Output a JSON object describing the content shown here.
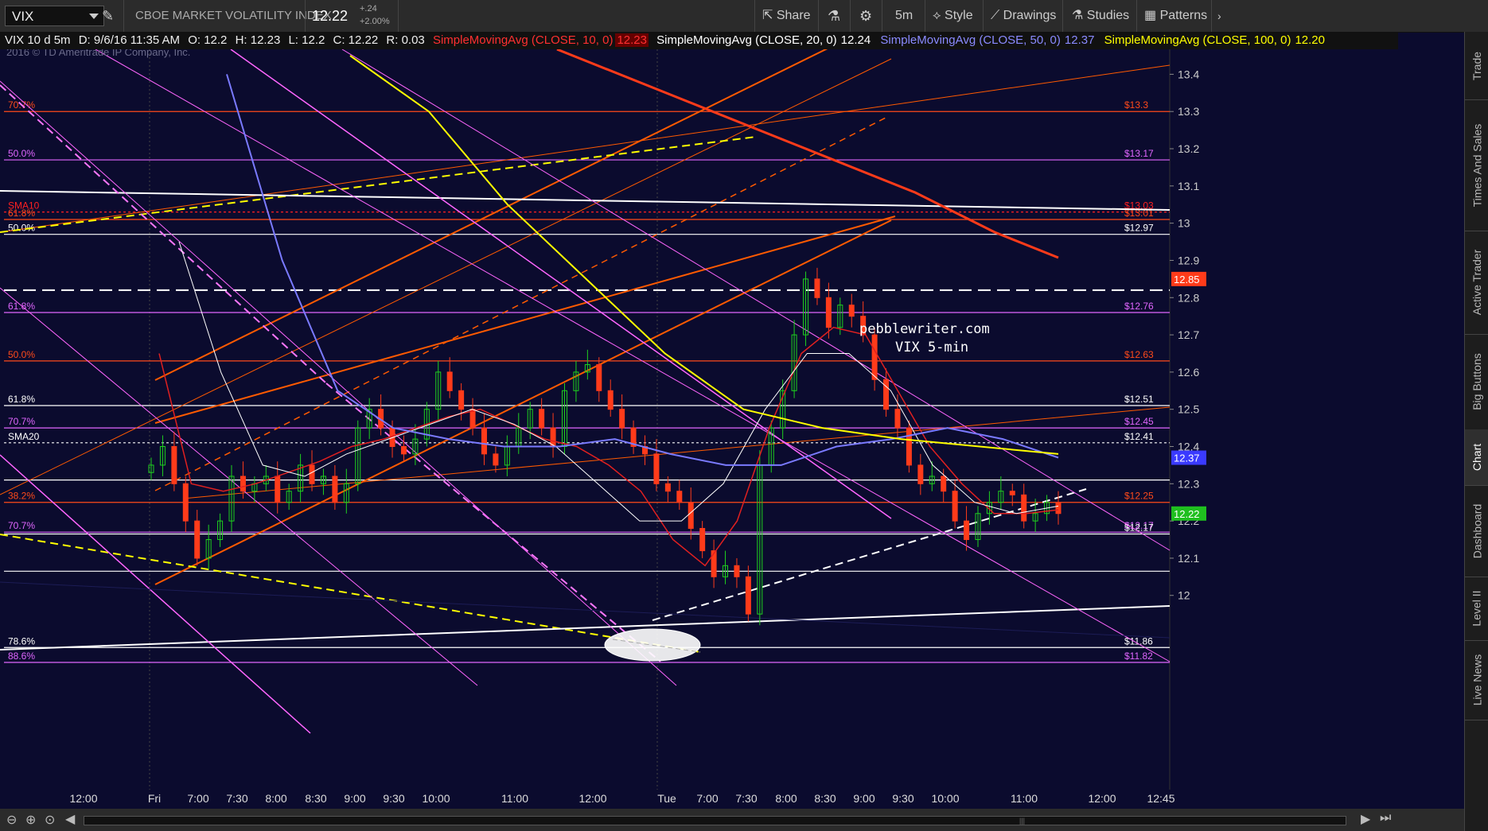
{
  "toolbar": {
    "symbol": "VIX",
    "description": "CBOE MARKET VOLATILITY INDEX",
    "last_price": "12.22",
    "change": "+.24",
    "change_pct": "+2.00%",
    "share_label": "Share",
    "timeframe": "5m",
    "style_label": "Style",
    "drawings_label": "Drawings",
    "studies_label": "Studies",
    "patterns_label": "Patterns"
  },
  "infobar": {
    "symbol_period": "VIX 10 d 5m",
    "date": "D: 9/6/16 11:35 AM",
    "open": "O: 12.2",
    "high": "H: 12.23",
    "low": "L: 12.2",
    "close": "C: 12.22",
    "range": "R: 0.03",
    "sma10_label": "SimpleMovingAvg (CLOSE, 10, 0)",
    "sma10_value": "12.23",
    "sma20_label": "SimpleMovingAvg (CLOSE, 20, 0)",
    "sma20_value": "12.24",
    "sma50_label": "SimpleMovingAvg (CLOSE, 50, 0)",
    "sma50_value": "12.37",
    "sma100_label": "SimpleMovingAvg (CLOSE, 100, 0)",
    "sma100_value": "12.20"
  },
  "sidebar": {
    "tabs": [
      "Trade",
      "Times And Sales",
      "Active Trader",
      "Big Buttons",
      "Chart",
      "Dashboard",
      "Level II",
      "Live News"
    ],
    "active": "Chart"
  },
  "colors": {
    "background": "#0b0b2e",
    "up": "#1fd01f",
    "down": "#ff3b1a",
    "sma10": "#e02020",
    "sma20": "#ffffff",
    "sma50": "#7a7aff",
    "sma100": "#ffff00",
    "fib_red": "#ff4a1a",
    "fib_magenta": "#e066ff",
    "trend_orange": "#ff5a00"
  },
  "chart_data": {
    "type": "candlestick",
    "copyright": "2016 © TD Ameritrade IP Company, Inc.",
    "annotation": [
      "pebblewriter.com",
      "VIX 5-min"
    ],
    "ylim": [
      11.82,
      13.45
    ],
    "y_ticks": [
      12,
      12.1,
      12.2,
      12.3,
      12.4,
      12.5,
      12.6,
      12.7,
      12.8,
      12.9,
      13,
      13.1,
      13.2,
      13.3,
      13.4
    ],
    "x_ticks": [
      "12:00",
      "Fri",
      "7:00",
      "7:30",
      "8:00",
      "8:30",
      "9:00",
      "9:30",
      "10:00",
      "11:00",
      "12:00",
      "Tue",
      "7:00",
      "7:30",
      "8:00",
      "8:30",
      "9:00",
      "9:30",
      "10:00",
      "11:00",
      "12:00",
      "12:45"
    ],
    "price_tags": [
      {
        "label": "12.85",
        "value": 12.85,
        "color": "#ff3b1a"
      },
      {
        "label": "12.37",
        "value": 12.37,
        "color": "#3a3aff"
      },
      {
        "label": "12.22",
        "value": 12.22,
        "color": "#1fbf1f"
      }
    ],
    "levels": [
      {
        "value": 13.3,
        "left": "70.7%",
        "right": "$13.3",
        "color": "#ff4a1a"
      },
      {
        "value": 13.17,
        "left": "50.0%",
        "right": "$13.17",
        "color": "#e066ff"
      },
      {
        "value": 13.03,
        "left": "SMA10",
        "right": "$13.03",
        "color": "#ff2020",
        "dash": true
      },
      {
        "value": 13.01,
        "left": "61.8%",
        "right": "$13.01",
        "color": "#ff4a1a"
      },
      {
        "value": 12.97,
        "left": "50.0%",
        "right": "$12.97",
        "color": "#ffffff"
      },
      {
        "value": 12.82,
        "left": "",
        "right": "",
        "color": "#ffffff",
        "dash": true
      },
      {
        "value": 12.76,
        "left": "61.8%",
        "right": "$12.76",
        "color": "#e066ff"
      },
      {
        "value": 12.63,
        "left": "50.0%",
        "right": "$12.63",
        "color": "#ff4a1a"
      },
      {
        "value": 12.51,
        "left": "61.8%",
        "right": "$12.51",
        "color": "#ffffff"
      },
      {
        "value": 12.45,
        "left": "70.7%",
        "right": "$12.45",
        "color": "#e066ff"
      },
      {
        "value": 12.41,
        "left": "SMA20",
        "right": "$12.41",
        "color": "#ffffff",
        "dash": true
      },
      {
        "value": 12.31,
        "left": "",
        "right": "",
        "color": "#ffffff"
      },
      {
        "value": 12.25,
        "left": "38.2%",
        "right": "$12.25",
        "color": "#ff4a1a"
      },
      {
        "value": 12.17,
        "left": "70.7%",
        "right": "$12.17",
        "color": "#e066ff"
      },
      {
        "value": 12.165,
        "left": "",
        "right": "$12.17",
        "color": "#ffffff"
      },
      {
        "value": 12.065,
        "left": "",
        "right": "",
        "color": "#ffffff"
      },
      {
        "value": 11.86,
        "left": "78.6%",
        "right": "$11.86",
        "color": "#ffffff"
      },
      {
        "value": 11.82,
        "left": "88.6%",
        "right": "$11.82",
        "color": "#e066ff"
      }
    ],
    "series": [
      {
        "name": "VIX",
        "values": [
          12.35,
          12.4,
          12.3,
          12.2,
          12.1,
          12.15,
          12.2,
          12.32,
          12.28,
          12.3,
          12.32,
          12.25,
          12.28,
          12.35,
          12.3,
          12.32,
          12.25,
          12.3,
          12.45,
          12.5,
          12.45,
          12.4,
          12.38,
          12.42,
          12.5,
          12.6,
          12.55,
          12.5,
          12.45,
          12.38,
          12.35,
          12.4,
          12.45,
          12.5,
          12.45,
          12.4,
          12.55,
          12.6,
          12.62,
          12.55,
          12.5,
          12.45,
          12.4,
          12.38,
          12.3,
          12.28,
          12.25,
          12.18,
          12.12,
          12.05,
          12.08,
          12.05,
          11.95,
          12.35,
          12.45,
          12.55,
          12.7,
          12.85,
          12.8,
          12.72,
          12.78,
          12.75,
          12.7,
          12.58,
          12.5,
          12.45,
          12.35,
          12.3,
          12.32,
          12.28,
          12.2,
          12.15,
          12.22,
          12.25,
          12.28,
          12.27,
          12.2,
          12.22,
          12.25,
          12.22
        ]
      },
      {
        "name": "SimpleMovingAvg (CLOSE, 10, 0)",
        "values": [
          12.65,
          12.3,
          12.28,
          12.3,
          12.33,
          12.36,
          12.4,
          12.42,
          12.45,
          12.48,
          12.5,
          12.46,
          12.42,
          12.4,
          12.35,
          12.28,
          12.15,
          12.08,
          12.2,
          12.45,
          12.65,
          12.72,
          12.7,
          12.55,
          12.4,
          12.3,
          12.22,
          12.22,
          12.23
        ]
      },
      {
        "name": "SimpleMovingAvg (CLOSE, 20, 0)",
        "values": [
          12.95,
          12.6,
          12.35,
          12.32,
          12.38,
          12.42,
          12.46,
          12.5,
          12.46,
          12.4,
          12.3,
          12.2,
          12.2,
          12.3,
          12.5,
          12.65,
          12.65,
          12.55,
          12.35,
          12.25,
          12.22,
          12.24
        ]
      },
      {
        "name": "SimpleMovingAvg (CLOSE, 50, 0)",
        "values": [
          13.4,
          12.9,
          12.55,
          12.45,
          12.42,
          12.4,
          12.4,
          12.42,
          12.38,
          12.35,
          12.35,
          12.4,
          12.42,
          12.45,
          12.42,
          12.37
        ]
      },
      {
        "name": "SimpleMovingAvg (CLOSE, 100, 0)",
        "values": [
          13.45,
          13.3,
          13.05,
          12.85,
          12.65,
          12.5,
          12.45,
          12.42,
          12.4,
          12.38
        ]
      }
    ]
  },
  "xaxis_labels": [
    {
      "t": "12:00",
      "x": 105
    },
    {
      "t": "Fri",
      "x": 194
    },
    {
      "t": "7:00",
      "x": 249
    },
    {
      "t": "7:30",
      "x": 298
    },
    {
      "t": "8:00",
      "x": 347
    },
    {
      "t": "8:30",
      "x": 397
    },
    {
      "t": "9:00",
      "x": 446
    },
    {
      "t": "9:30",
      "x": 495
    },
    {
      "t": "10:00",
      "x": 548
    },
    {
      "t": "11:00",
      "x": 647
    },
    {
      "t": "12:00",
      "x": 745
    },
    {
      "t": "Tue",
      "x": 838
    },
    {
      "t": "7:00",
      "x": 889
    },
    {
      "t": "7:30",
      "x": 938
    },
    {
      "t": "8:00",
      "x": 988
    },
    {
      "t": "8:30",
      "x": 1037
    },
    {
      "t": "9:00",
      "x": 1086
    },
    {
      "t": "9:30",
      "x": 1135
    },
    {
      "t": "10:00",
      "x": 1188
    },
    {
      "t": "11:00",
      "x": 1287
    },
    {
      "t": "12:00",
      "x": 1385
    },
    {
      "t": "12:45",
      "x": 1459
    }
  ]
}
